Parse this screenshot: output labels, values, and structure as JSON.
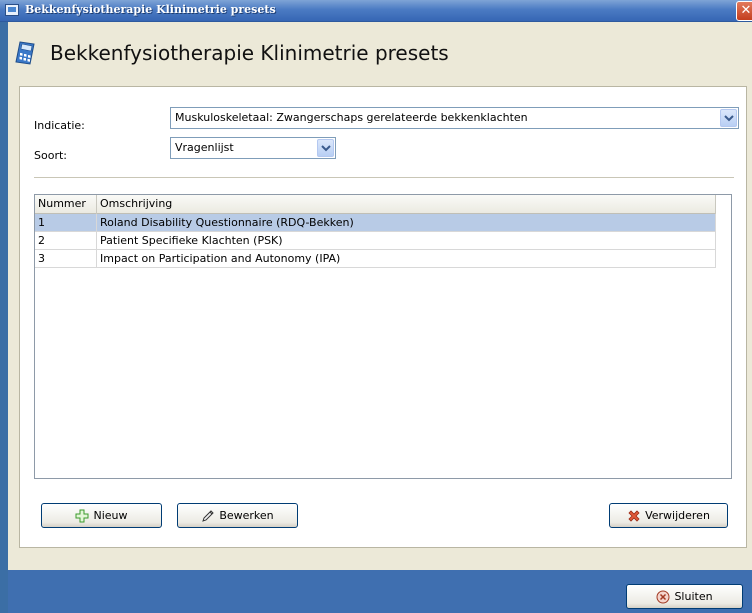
{
  "window": {
    "title": "Bekkenfysiotherapie Klinimetrie presets",
    "close_glyph": "✕"
  },
  "header": {
    "title": "Bekkenfysiotherapie Klinimetrie presets",
    "icon": "calculator-icon"
  },
  "form": {
    "indicatie_label": "Indicatie:",
    "indicatie_value": "Muskuloskeletaal: Zwangerschaps gerelateerde bekkenklachten",
    "soort_label": "Soort:",
    "soort_value": "Vragenlijst"
  },
  "table": {
    "columns": [
      "Nummer",
      "Omschrijving"
    ],
    "rows": [
      {
        "nummer": "1",
        "omschrijving": "Roland Disability Questionnaire (RDQ-Bekken)",
        "selected": true
      },
      {
        "nummer": "2",
        "omschrijving": "Patient Specifieke Klachten (PSK)",
        "selected": false
      },
      {
        "nummer": "3",
        "omschrijving": "Impact on Participation and Autonomy (IPA)",
        "selected": false
      }
    ]
  },
  "buttons": {
    "nieuw": "Nieuw",
    "bewerken": "Bewerken",
    "verwijderen": "Verwijderen",
    "sluiten": "Sluiten"
  },
  "colors": {
    "titlebar": "#3666b4",
    "selected_row": "#b8cbe6",
    "window_bg": "#ece9d8"
  }
}
